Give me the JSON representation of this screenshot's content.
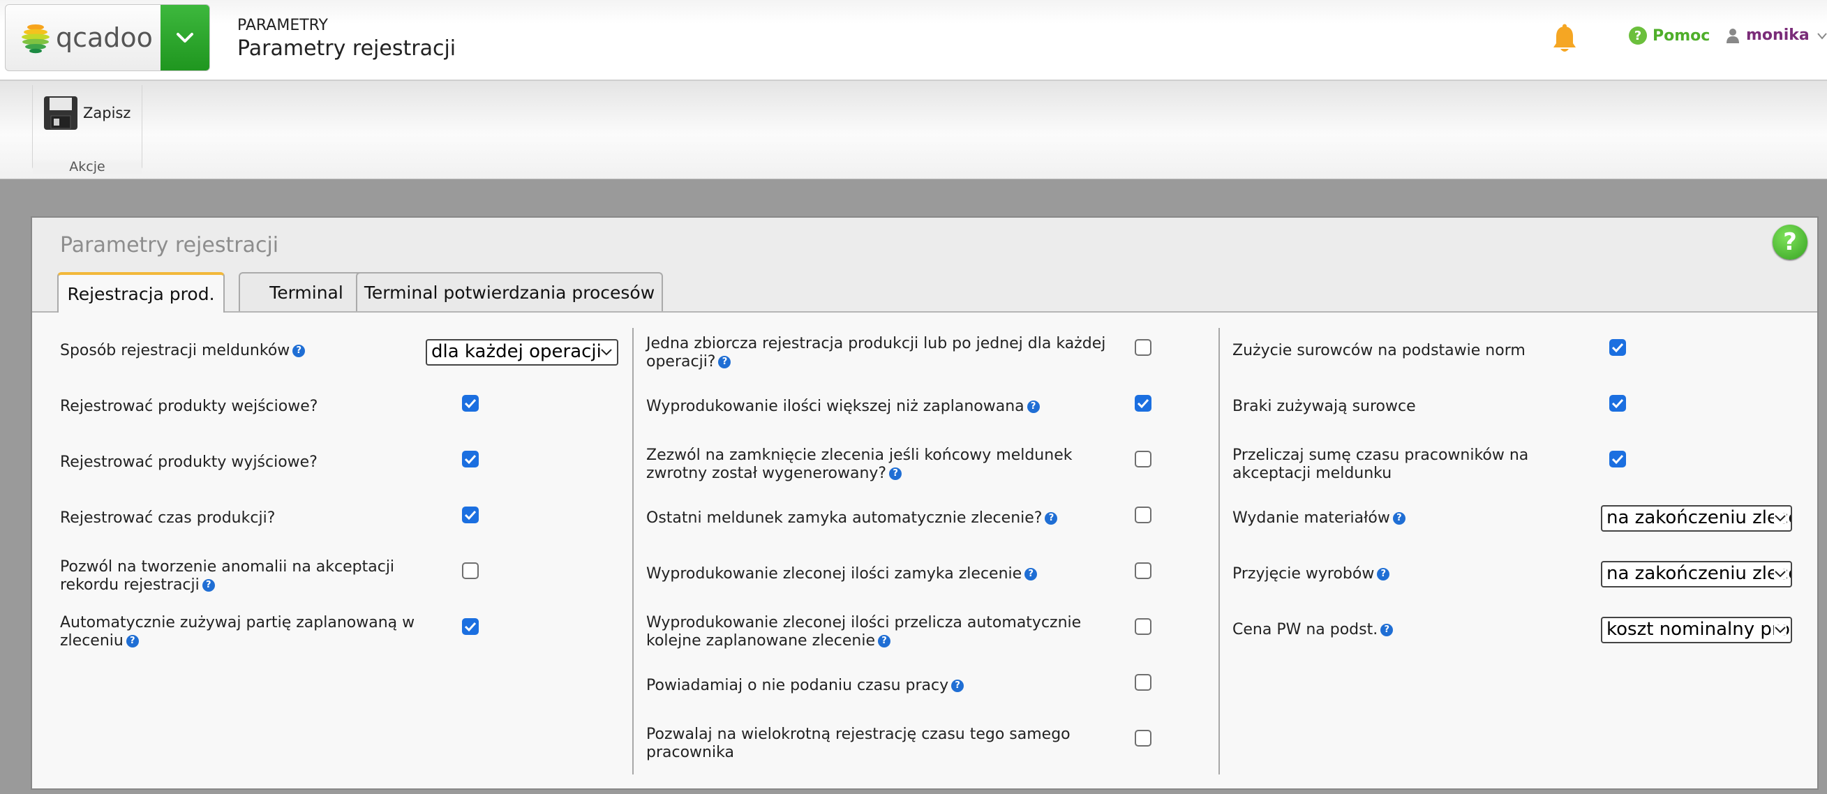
{
  "header": {
    "logo_text": "qcadoo",
    "section": "PARAMETRY",
    "title": "Parametry rejestracji",
    "help_label": "Pomoc",
    "user_name": "monika"
  },
  "actions": {
    "save_label": "Zapisz",
    "group_label": "Akcje"
  },
  "panel": {
    "title": "Parametry rejestracji",
    "help_glyph": "?",
    "tabs": [
      {
        "label": "Rejestracja prod.",
        "active": true
      },
      {
        "label": "Terminal",
        "active": false
      },
      {
        "label": "Terminal potwierdzania procesów",
        "active": false
      }
    ]
  },
  "col1": {
    "registration_mode": {
      "label": "Sposób rejestracji meldunków",
      "value": "dla każdej operacji"
    },
    "input_products": {
      "label": "Rejestrować produkty wejściowe?",
      "checked": true
    },
    "output_products": {
      "label": "Rejestrować produkty wyjściowe?",
      "checked": true
    },
    "production_time": {
      "label": "Rejestrować czas produkcji?",
      "checked": true
    },
    "anomalies": {
      "line1": "Pozwól na tworzenie anomalii na akceptacji",
      "line2": "rekordu rejestracji",
      "checked": false
    },
    "auto_batch": {
      "line1": "Automatycznie zużywaj partię zaplanowaną w",
      "line2": "zleceniu",
      "checked": true
    }
  },
  "col2": {
    "cumulative": {
      "line1": "Jedna zbiorcza rejestracja produkcji lub po jednej dla każdej",
      "line2": "operacji?",
      "checked": false
    },
    "overproduction": {
      "label": "Wyprodukowanie ilości większej niż zaplanowana",
      "checked": true
    },
    "close_on_return": {
      "line1": "Zezwól na zamknięcie zlecenia jeśli końcowy meldunek",
      "line2": "zwrotny został wygenerowany?",
      "checked": false
    },
    "last_closes": {
      "label": "Ostatni meldunek zamyka automatycznie zlecenie?",
      "checked": false
    },
    "quantity_closes": {
      "label": "Wyprodukowanie zleconej ilości zamyka zlecenie",
      "checked": false
    },
    "recalculate": {
      "line1": "Wyprodukowanie zleconej ilości przelicza automatycznie",
      "line2": "kolejne zaplanowane zlecenie",
      "checked": false
    },
    "notify_time": {
      "label": "Powiadamiaj o nie podaniu czasu pracy",
      "checked": false
    },
    "multi_time": {
      "line1": "Pozwalaj na wielokrotną rejestrację czasu tego samego",
      "line2": "pracownika",
      "checked": false
    }
  },
  "col3": {
    "norm_consumption": {
      "label": "Zużycie surowców na podstawie norm",
      "checked": true
    },
    "waste_consumes": {
      "label": "Braki zużywają surowce",
      "checked": true
    },
    "recalc_worker_time": {
      "line1": "Przeliczaj sumę czasu pracowników na",
      "line2": "akceptacji meldunku",
      "checked": true
    },
    "material_issue": {
      "label": "Wydanie materiałów",
      "value": "na zakończeniu zlecenia"
    },
    "product_receipt": {
      "label": "Przyjęcie wyrobów",
      "value": "na zakończeniu zlecenia"
    },
    "pw_price": {
      "label": "Cena PW na podst.",
      "value": "koszt nominalny produktu"
    }
  },
  "colors": {
    "accent_green": "#1f961f",
    "checkbox_blue": "#1b6fe0",
    "help_green": "#4fae2a",
    "user_purple": "#7a2c78",
    "tab_active_border": "#f2b83a"
  },
  "icons": [
    "qcadoo-logo",
    "chevron-down-icon",
    "bell-icon",
    "help-icon",
    "user-icon",
    "save-icon",
    "info-icon",
    "checkmark-icon"
  ]
}
